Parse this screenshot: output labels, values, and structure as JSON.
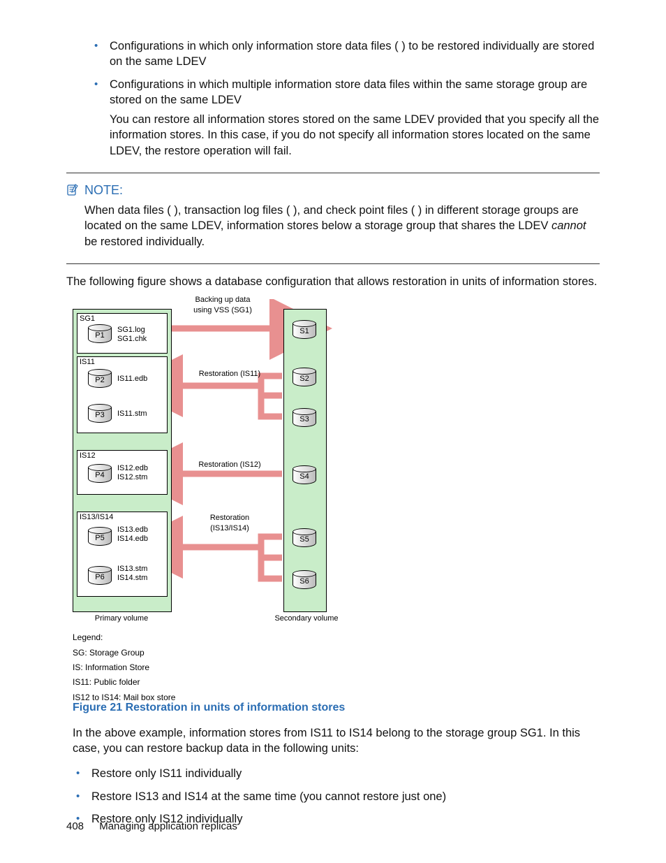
{
  "bullets_top": [
    {
      "text": "Configurations in which only information store data files (            ) to be restored individually are stored on the same LDEV"
    },
    {
      "text": "Configurations in which multiple information store data files within the same storage group are stored on the same LDEV",
      "sub": "You can restore all information stores stored on the same LDEV provided that you specify all the information stores. In this case, if you do not specify all information stores located on the same LDEV, the restore operation will fail."
    }
  ],
  "note": {
    "label": "NOTE:",
    "body_1": "When data files (              ), transaction log files (              ), and check point files (              ) in different storage groups are located on the same LDEV, information stores below a storage group that shares the LDEV ",
    "body_em": "cannot",
    "body_2": " be restored individually."
  },
  "para_after_note": "The following figure shows a database configuration that allows restoration in units of information stores.",
  "diagram": {
    "backup_label": "Backing up data\nusing VSS (SG1)",
    "primary_label": "Primary volume",
    "secondary_label": "Secondary volume",
    "sg_label": "SG1",
    "sg_files": "SG1.log\nSG1.chk",
    "is11": "IS11",
    "is12": "IS12",
    "is1314": "IS13/IS14",
    "p": [
      "P1",
      "P2",
      "P3",
      "P4",
      "P5",
      "P6"
    ],
    "s": [
      "S1",
      "S2",
      "S3",
      "S4",
      "S5",
      "S6"
    ],
    "f_is11_edb": "IS11.edb",
    "f_is11_stm": "IS11.stm",
    "f_is12": "IS12.edb\nIS12.stm",
    "f_is13_edb": "IS13.edb\nIS14.edb",
    "f_is13_stm": "IS13.stm\nIS14.stm",
    "rest11": "Restoration (IS11)",
    "rest12": "Restoration (IS12)",
    "rest1314": "Restoration\n(IS13/IS14)"
  },
  "legend": {
    "title": "Legend:",
    "l1": "SG: Storage Group",
    "l2": "IS: Information Store",
    "l3": "IS11: Public folder",
    "l4": "IS12 to IS14: Mail box store"
  },
  "figure_caption": "Figure 21 Restoration in units of information stores",
  "para_after_fig": "In the above example, information stores from IS11 to IS14 belong to the storage group SG1. In this case, you can restore backup data in the following units:",
  "bullets_bottom": [
    "Restore only IS11 individually",
    "Restore IS13 and IS14 at the same time (you cannot restore just one)",
    "Restore only IS12 individually"
  ],
  "footer": {
    "page": "408",
    "title": "Managing application replicas"
  }
}
